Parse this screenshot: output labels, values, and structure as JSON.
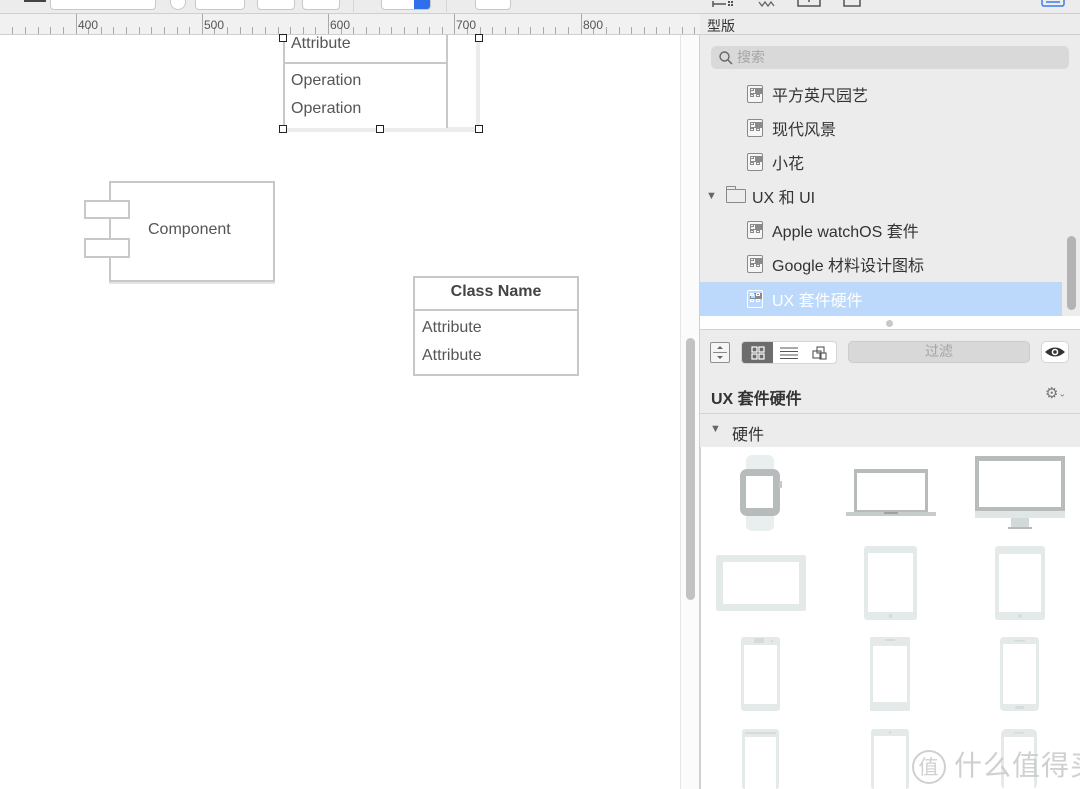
{
  "ruler": {
    "labels": [
      "400",
      "500",
      "600",
      "700",
      "800"
    ]
  },
  "canvas": {
    "class_top": {
      "attribute": "Attribute",
      "operations": [
        "Operation",
        "Operation"
      ]
    },
    "component": {
      "label": "Component"
    },
    "class_box": {
      "name": "Class Name",
      "attributes": [
        "Attribute",
        "Attribute"
      ]
    }
  },
  "sidebar": {
    "section_title": "型版",
    "search_placeholder": "搜索",
    "libraries": [
      {
        "label": "平方英尺园艺",
        "type": "stencil",
        "icon": "stencil-icon"
      },
      {
        "label": "现代风景",
        "type": "stencil",
        "icon": "stencil-icon"
      },
      {
        "label": "小花",
        "type": "stencil",
        "icon": "stencil-icon"
      },
      {
        "label": "UX 和 UI",
        "type": "folder",
        "icon": "folder-icon",
        "expanded": true
      },
      {
        "label": "Apple watchOS 套件",
        "type": "stencil",
        "icon": "stencil-icon"
      },
      {
        "label": "Google 材料设计图标",
        "type": "stencil",
        "icon": "stencil-icon"
      },
      {
        "label": "UX 套件硬件",
        "type": "stencil",
        "icon": "stencil-icon",
        "selected": true
      }
    ],
    "view_modes": [
      "grid-icon",
      "list-icon",
      "outline-icon"
    ],
    "active_view_mode": "grid",
    "filter_placeholder": "过滤",
    "library_title": "UX 套件硬件",
    "group_label": "硬件",
    "shapes": [
      "apple-watch",
      "laptop",
      "desktop-monitor",
      "tablet-landscape",
      "tablet-portrait",
      "tablet-portrait-2",
      "phone-android",
      "phone-generic",
      "phone-iphone",
      "phone-4",
      "phone-5",
      "phone-6"
    ],
    "selection_color": "#bcd8fb"
  },
  "watermark": {
    "badge": "值",
    "text": "什么值得买"
  }
}
